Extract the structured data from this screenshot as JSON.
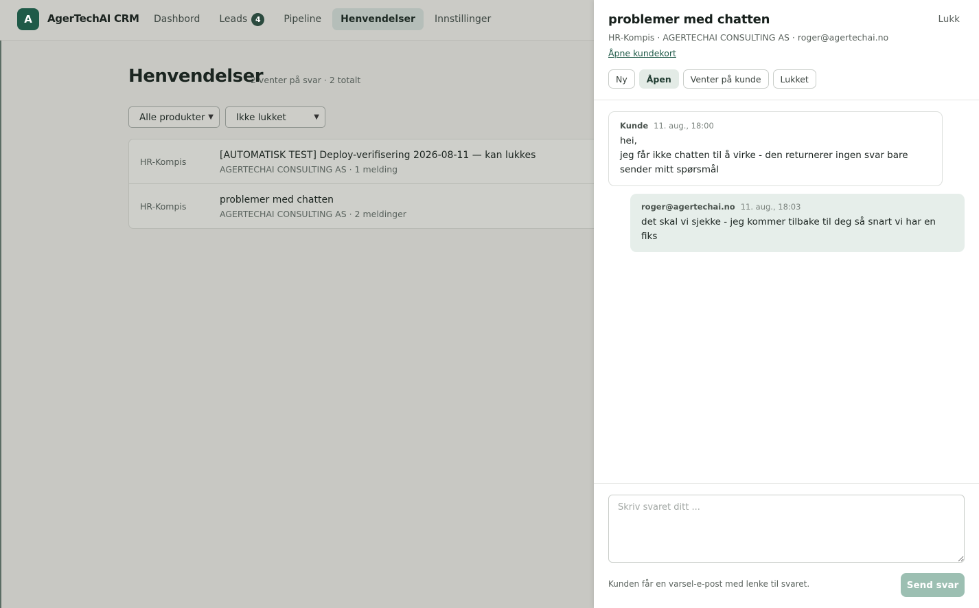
{
  "app": {
    "logo_letter": "A",
    "name": "AgerTechAI CRM"
  },
  "nav": {
    "items": [
      {
        "label": "Dashbord"
      },
      {
        "label": "Leads",
        "badge": "4"
      },
      {
        "label": "Pipeline"
      },
      {
        "label": "Henvendelser",
        "active": true
      },
      {
        "label": "Innstillinger"
      }
    ]
  },
  "page": {
    "title": "Henvendelser",
    "subtitle": "2 venter på svar · 2 totalt"
  },
  "filters": {
    "product_select": "Alle produkter",
    "status_select": "Ikke lukket"
  },
  "list": {
    "rows": [
      {
        "product": "HR-Kompis",
        "title": "[AUTOMATISK TEST] Deploy-verifisering 2026-08-11 — kan lukkes",
        "meta": "AGERTECHAI CONSULTING AS · 1 melding"
      },
      {
        "product": "HR-Kompis",
        "title": "problemer med chatten",
        "meta": "AGERTECHAI CONSULTING AS · 2 meldinger"
      }
    ]
  },
  "drawer": {
    "title": "problemer med chatten",
    "close_label": "Lukk",
    "meta": "HR-Kompis · AGERTECHAI CONSULTING AS · roger@agertechai.no",
    "customer_link": "Åpne kundekort",
    "statuses": [
      {
        "label": "Ny"
      },
      {
        "label": "Åpen",
        "active": true
      },
      {
        "label": "Venter på kunde"
      },
      {
        "label": "Lukket"
      }
    ],
    "messages": [
      {
        "author": "Kunde",
        "time": "11. aug., 18:00",
        "body": "hei,\njeg får ikke chatten til å virke - den returnerer ingen svar bare sender mitt spørsmål"
      },
      {
        "author": "roger@agertechai.no",
        "time": "11. aug., 18:03",
        "body": "det skal vi sjekke - jeg kommer tilbake til deg så snart vi har en fiks"
      }
    ],
    "reply_placeholder": "Skriv svaret ditt ...",
    "footer_note": "Kunden får en varsel-e-post med lenke til svaret.",
    "send_label": "Send svar"
  },
  "colors": {
    "accent": "#1f5a48",
    "send_button_disabled": "#9cbfb2",
    "outgoing_bubble": "#e6eeea"
  }
}
